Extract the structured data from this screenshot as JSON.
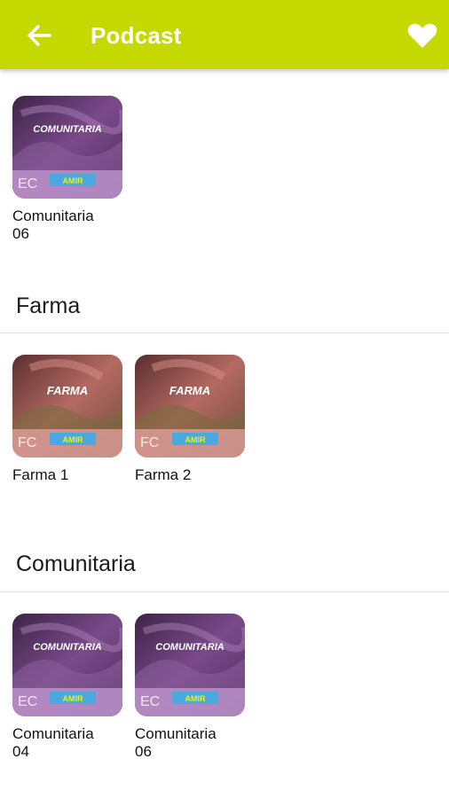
{
  "appbar": {
    "title": "Podcast",
    "back_icon": "arrow-left-icon",
    "favorite_icon": "heart-icon",
    "color": "#c5d900"
  },
  "top_section": {
    "items": [
      {
        "label": "Comunitaria\n06",
        "cover_title": "COMUNITARIA",
        "cover_code": "EC",
        "cover_brand": "AMIR"
      }
    ]
  },
  "sections": [
    {
      "title": "Farma",
      "items": [
        {
          "label": "Farma 1",
          "cover_title": "FARMA",
          "cover_code": "FC",
          "cover_brand": "AMIR"
        },
        {
          "label": "Farma 2",
          "cover_title": "FARMA",
          "cover_code": "FC",
          "cover_brand": "AMIR"
        }
      ]
    },
    {
      "title": "Comunitaria",
      "items": [
        {
          "label": "Comunitaria\n04",
          "cover_title": "COMUNITARIA",
          "cover_code": "EC",
          "cover_brand": "AMIR"
        },
        {
          "label": "Comunitaria\n06",
          "cover_title": "COMUNITARIA",
          "cover_code": "EC",
          "cover_brand": "AMIR"
        }
      ]
    }
  ],
  "colors": {
    "comunitaria_cover": "#6b3f7a",
    "farma_cover": "#a65a55",
    "brand_band": "#4aa9e0"
  }
}
